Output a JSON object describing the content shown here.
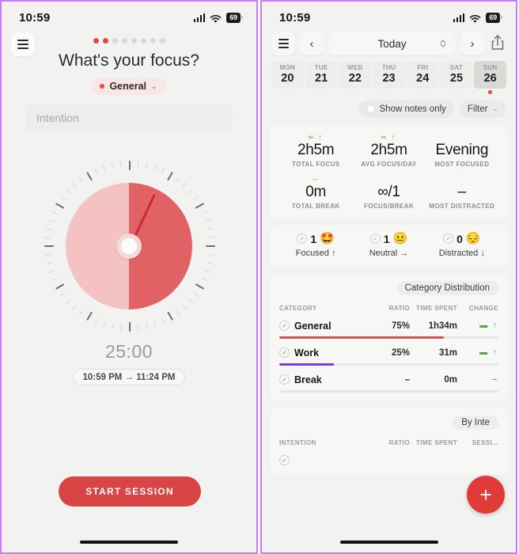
{
  "statusbar": {
    "time": "10:59",
    "battery": "69"
  },
  "left": {
    "dots": {
      "total": 8,
      "active": 2
    },
    "title": "What's your focus?",
    "category_chip": {
      "label": "General",
      "color": "#e8493f",
      "chevron": "⌄"
    },
    "intention_placeholder": "Intention",
    "timer": {
      "value": "25:00",
      "range": "10:59 PM → 11:24 PM",
      "progress_percent": 50
    },
    "start_button": "START SESSION"
  },
  "right": {
    "toolbar": {
      "prev": "‹",
      "period": "Today",
      "next": "›"
    },
    "days": [
      {
        "dow": "MON",
        "num": "20",
        "selected": false,
        "dot": false
      },
      {
        "dow": "TUE",
        "num": "21",
        "selected": false,
        "dot": false
      },
      {
        "dow": "WED",
        "num": "22",
        "selected": false,
        "dot": false
      },
      {
        "dow": "THU",
        "num": "23",
        "selected": false,
        "dot": false
      },
      {
        "dow": "FRI",
        "num": "24",
        "selected": false,
        "dot": false
      },
      {
        "dow": "SAT",
        "num": "25",
        "selected": false,
        "dot": false
      },
      {
        "dow": "SUN",
        "num": "26",
        "selected": true,
        "dot": true
      }
    ],
    "filters": {
      "notes_only": "Show notes only",
      "filter": "Filter",
      "chevron": "⌄"
    },
    "stats": [
      {
        "delta": "∞ ↑",
        "value": "2h5m",
        "label": "TOTAL FOCUS"
      },
      {
        "delta": "∞ ↑",
        "value": "2h5m",
        "label": "AVG FOCUS/DAY"
      },
      {
        "delta": "",
        "value": "Evening",
        "label": "MOST FOCUSED"
      },
      {
        "delta": "–",
        "value": "0m",
        "label": "TOTAL BREAK"
      },
      {
        "delta": "",
        "value": "∞/1",
        "label": "FOCUS/BREAK"
      },
      {
        "delta": "",
        "value": "–",
        "label": "MOST DISTRACTED"
      }
    ],
    "moods": [
      {
        "count": "1",
        "emoji": "🤩",
        "label": "Focused ↑"
      },
      {
        "count": "1",
        "emoji": "😐",
        "label": "Neutral →"
      },
      {
        "count": "0",
        "emoji": "😔",
        "label": "Distracted ↓"
      }
    ],
    "category_section": {
      "title": "Category Distribution",
      "headers": {
        "name": "CATEGORY",
        "ratio": "RATIO",
        "time": "TIME SPENT",
        "change": "CHANGE"
      },
      "rows": [
        {
          "name": "General",
          "ratio": "75%",
          "time": "1h34m",
          "change": "▬ ↑",
          "bar_percent": 75,
          "color": "#e0504e"
        },
        {
          "name": "Work",
          "ratio": "25%",
          "time": "31m",
          "change": "▬ ↑",
          "bar_percent": 25,
          "color": "#7a3fe0"
        },
        {
          "name": "Break",
          "ratio": "–",
          "time": "0m",
          "change": "–",
          "bar_percent": 0,
          "color": "#e6e6e4"
        }
      ]
    },
    "intention_section": {
      "title": "By Inte",
      "headers": {
        "name": "INTENTION",
        "ratio": "RATIO",
        "time": "TIME SPENT",
        "sessions": "SESSI..."
      }
    },
    "fab": "+"
  }
}
